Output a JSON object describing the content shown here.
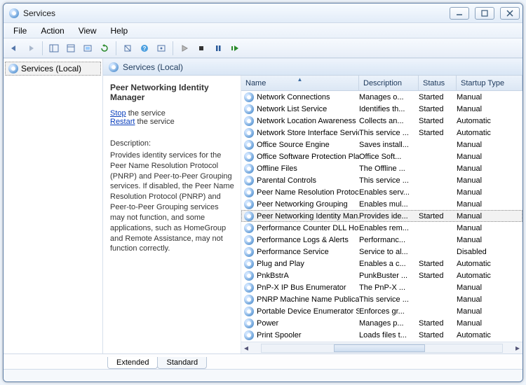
{
  "window": {
    "title": "Services"
  },
  "menu": {
    "file": "File",
    "action": "Action",
    "view": "View",
    "help": "Help"
  },
  "tree": {
    "root": "Services (Local)"
  },
  "pane": {
    "header": "Services (Local)"
  },
  "detail": {
    "title": "Peer Networking Identity Manager",
    "stop_link": "Stop",
    "stop_suffix": " the service",
    "restart_link": "Restart",
    "restart_suffix": " the service",
    "desc_label": "Description:",
    "desc_text": "Provides identity services for the Peer Name Resolution Protocol (PNRP) and Peer-to-Peer Grouping services. If disabled, the Peer Name Resolution Protocol (PNRP) and Peer-to-Peer Grouping services may not function, and some applications, such as HomeGroup and Remote Assistance, may not function correctly."
  },
  "columns": {
    "name": "Name",
    "desc": "Description",
    "status": "Status",
    "startup": "Startup Type"
  },
  "services": [
    {
      "name": "Network Connections",
      "desc": "Manages o...",
      "status": "Started",
      "startup": "Manual",
      "sel": false
    },
    {
      "name": "Network List Service",
      "desc": "Identifies th...",
      "status": "Started",
      "startup": "Manual",
      "sel": false
    },
    {
      "name": "Network Location Awareness",
      "desc": "Collects an...",
      "status": "Started",
      "startup": "Automatic",
      "sel": false
    },
    {
      "name": "Network Store Interface Service",
      "desc": "This service ...",
      "status": "Started",
      "startup": "Automatic",
      "sel": false
    },
    {
      "name": "Office  Source Engine",
      "desc": "Saves install...",
      "status": "",
      "startup": "Manual",
      "sel": false
    },
    {
      "name": "Office Software Protection Platf...",
      "desc": "Office Soft...",
      "status": "",
      "startup": "Manual",
      "sel": false
    },
    {
      "name": "Offline Files",
      "desc": "The Offline ...",
      "status": "",
      "startup": "Manual",
      "sel": false
    },
    {
      "name": "Parental Controls",
      "desc": "This service ...",
      "status": "",
      "startup": "Manual",
      "sel": false
    },
    {
      "name": "Peer Name Resolution Protocol",
      "desc": "Enables serv...",
      "status": "",
      "startup": "Manual",
      "sel": false
    },
    {
      "name": "Peer Networking Grouping",
      "desc": "Enables mul...",
      "status": "",
      "startup": "Manual",
      "sel": false
    },
    {
      "name": "Peer Networking Identity Man...",
      "desc": "Provides ide...",
      "status": "Started",
      "startup": "Manual",
      "sel": true
    },
    {
      "name": "Performance Counter DLL Host",
      "desc": "Enables rem...",
      "status": "",
      "startup": "Manual",
      "sel": false
    },
    {
      "name": "Performance Logs & Alerts",
      "desc": "Performanc...",
      "status": "",
      "startup": "Manual",
      "sel": false
    },
    {
      "name": "Performance Service",
      "desc": "Service to al...",
      "status": "",
      "startup": "Disabled",
      "sel": false
    },
    {
      "name": "Plug and Play",
      "desc": "Enables a c...",
      "status": "Started",
      "startup": "Automatic",
      "sel": false
    },
    {
      "name": "PnkBstrA",
      "desc": "PunkBuster ...",
      "status": "Started",
      "startup": "Automatic",
      "sel": false
    },
    {
      "name": "PnP-X IP Bus Enumerator",
      "desc": "The PnP-X ...",
      "status": "",
      "startup": "Manual",
      "sel": false
    },
    {
      "name": "PNRP Machine Name Publicati...",
      "desc": "This service ...",
      "status": "",
      "startup": "Manual",
      "sel": false
    },
    {
      "name": "Portable Device Enumerator Ser...",
      "desc": "Enforces gr...",
      "status": "",
      "startup": "Manual",
      "sel": false
    },
    {
      "name": "Power",
      "desc": "Manages p...",
      "status": "Started",
      "startup": "Manual",
      "sel": false
    },
    {
      "name": "Print Spooler",
      "desc": "Loads files t...",
      "status": "Started",
      "startup": "Automatic",
      "sel": false
    }
  ],
  "tabs": {
    "extended": "Extended",
    "standard": "Standard"
  }
}
